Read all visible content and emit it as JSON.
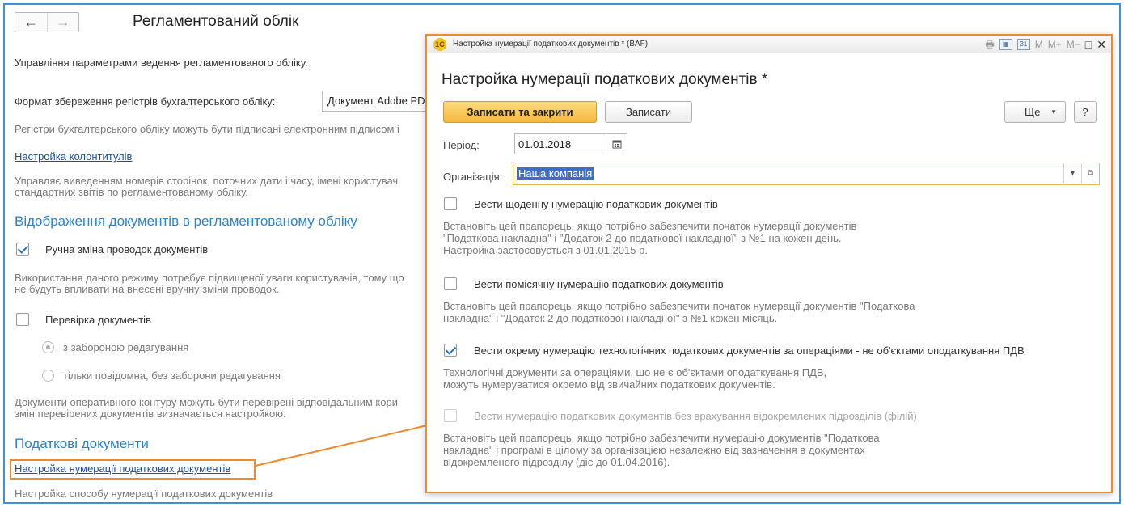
{
  "background": {
    "title": "Регламентований облік",
    "subtitle": "Управління параметрами ведення регламентованого обліку.",
    "format_label": "Формат збереження регістрів бухгалтерського обліку:",
    "format_value": "Документ Adobe PDF",
    "signature_note": "Регістри бухгалтерського обліку можуть бути підписані електронним підписом і",
    "headers_link": "Настройка колонтитулів",
    "headers_desc_1": "Управляє виведенням номерів сторінок, поточних дати і часу, імені користувач",
    "headers_desc_2": "стандартних звітів по регламентованому обліку.",
    "section_display": "Відображення документів в регламентованому обліку",
    "manual_change_label": "Ручна зміна проводок документів",
    "manual_change_desc_1": "Використання даного режиму потребує підвищеної уваги користувачів, тому що",
    "manual_change_desc_2": "не будуть впливати на внесені вручну зміни проводок.",
    "check_docs_label": "Перевірка документів",
    "radio_forbid": "з забороною редагування",
    "radio_notify": "тільки повідомна, без заборони редагування",
    "check_docs_desc_1": "Документи оперативного контуру можуть бути перевірені відповідальним кори",
    "check_docs_desc_2": "змін перевірених документів визначається настройкою.",
    "section_tax": "Податкові документи",
    "tax_link": "Настройка нумерації податкових документів",
    "tax_link_desc": "Настройка способу нумерації податкових документів"
  },
  "modal": {
    "window_title": "Настройка нумерації податкових документів * (BAF)",
    "app_icon": "1С",
    "tools": {
      "m": "M",
      "m_plus": "M+",
      "m_minus": "M−",
      "maximize": "□",
      "close": "✕"
    },
    "title": "Настройка нумерації податкових документів *",
    "save_close_label": "Записати та закрити",
    "save_label": "Записати",
    "more_label": "Ще",
    "help_label": "?",
    "period_label": "Період:",
    "period_value": "01.01.2018",
    "org_label": "Організація:",
    "org_value": "Наша компанія",
    "opt_daily_label": "Вести щоденну нумерацію податкових документів",
    "opt_daily_desc": [
      "Встановіть цей прапорець, якщо потрібно забезпечити початок нумерації документів",
      "\"Податкова накладна\" і \"Додаток 2 до податкової накладної\" з №1 на кожен день.",
      "Настройка застосовується з 01.01.2015 р."
    ],
    "opt_monthly_label": "Вести помісячну нумерацію податкових документів",
    "opt_monthly_desc": [
      "Встановіть цей прапорець, якщо потрібно забезпечити початок нумерації документів \"Податкова",
      "накладна\" і \"Додаток 2 до податкової накладної\" з №1 кожен місяць."
    ],
    "opt_separate_label": "Вести окрему нумерацію технологічних податкових документів за операціями - не об'єктами оподаткування ПДВ",
    "opt_separate_desc": [
      "Технологічні документи за операціями, що не є об'єктами оподаткування ПДВ,",
      "можуть нумеруватися окремо від звичайних податкових документів."
    ],
    "opt_branches_label": "Вести нумерацію податкових документів без врахування відокремлених підрозділів (філій)",
    "opt_branches_desc": [
      "Встановіть цей прапорець, якщо потрібно забезпечити нумерацію документів \"Податкова",
      "накладна\" і програмі в цілому за організацією незалежно від зазначення в документах",
      "відокремленого підрозділу (діє до 01.04.2016)."
    ]
  },
  "colors": {
    "accent_blue": "#2c84c9",
    "highlight_orange": "#f08a2c",
    "primary_button": "#f4b73e"
  }
}
